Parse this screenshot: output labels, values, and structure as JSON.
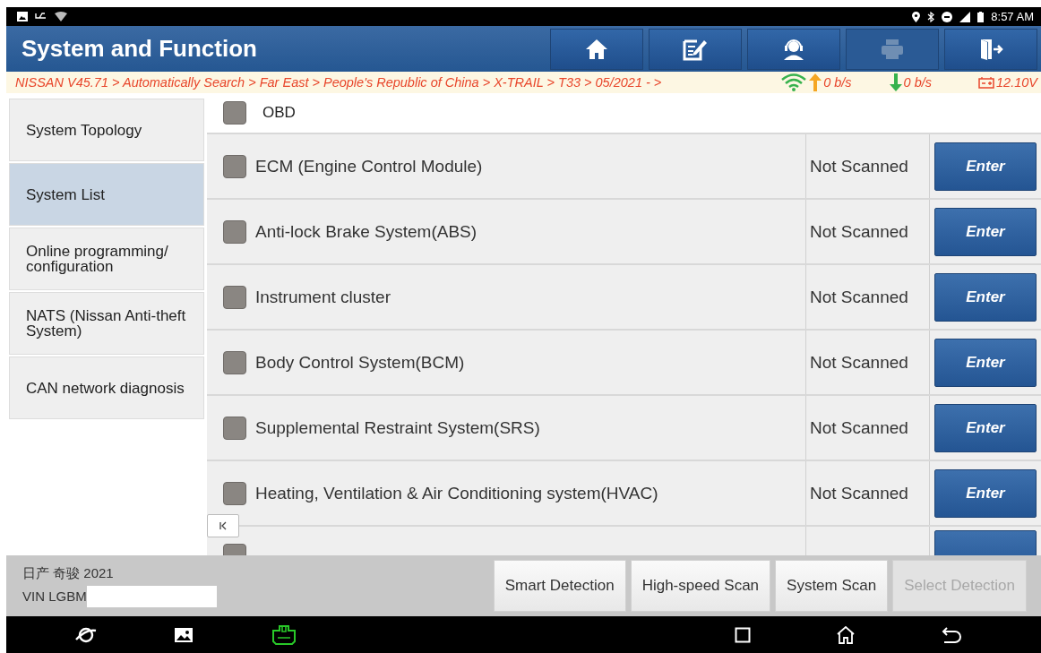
{
  "status_bar": {
    "time": "8:57 AM"
  },
  "header": {
    "title": "System and Function",
    "buttons": [
      {
        "kind": "home",
        "disabled": false
      },
      {
        "kind": "edit",
        "disabled": false
      },
      {
        "kind": "support",
        "disabled": false
      },
      {
        "kind": "print",
        "disabled": true
      },
      {
        "kind": "exit",
        "disabled": false
      }
    ]
  },
  "breadcrumb": {
    "path": "NISSAN V45.71 > Automatically Search > Far East > People's Republic of China > X-TRAIL > T33 > 05/2021 - >",
    "upload": "0 b/s",
    "download": "0 b/s",
    "voltage": "12.10V"
  },
  "sidebar": {
    "items": [
      {
        "label": "System Topology",
        "selected": false
      },
      {
        "label": "System List",
        "selected": true
      },
      {
        "label": "Online programming/ configuration",
        "selected": false
      },
      {
        "label": "NATS (Nissan Anti-theft System)",
        "selected": false
      },
      {
        "label": "CAN network diagnosis",
        "selected": false
      }
    ]
  },
  "select_all": {
    "label": "OBD",
    "checked": false
  },
  "systems": [
    {
      "name": "ECM (Engine Control Module)",
      "checked": false,
      "status": "Not Scanned",
      "action": "Enter"
    },
    {
      "name": "Anti-lock Brake System(ABS)",
      "checked": false,
      "status": "Not Scanned",
      "action": "Enter"
    },
    {
      "name": "Instrument cluster",
      "checked": false,
      "status": "Not Scanned",
      "action": "Enter"
    },
    {
      "name": "Body Control System(BCM)",
      "checked": false,
      "status": "Not Scanned",
      "action": "Enter"
    },
    {
      "name": "Supplemental Restraint System(SRS)",
      "checked": false,
      "status": "Not Scanned",
      "action": "Enter"
    },
    {
      "name": "Heating, Ventilation & Air Conditioning system(HVAC)",
      "checked": false,
      "status": "Not Scanned",
      "action": "Enter"
    }
  ],
  "partial_row": {
    "checked": false
  },
  "vehicle": {
    "model": "日产 奇骏 2021",
    "vin": "VIN LGBM"
  },
  "actions": [
    {
      "label": "Smart Detection",
      "disabled": false
    },
    {
      "label": "High-speed Scan",
      "disabled": false
    },
    {
      "label": "System Scan",
      "disabled": false
    },
    {
      "label": "Select Detection",
      "disabled": true
    }
  ]
}
